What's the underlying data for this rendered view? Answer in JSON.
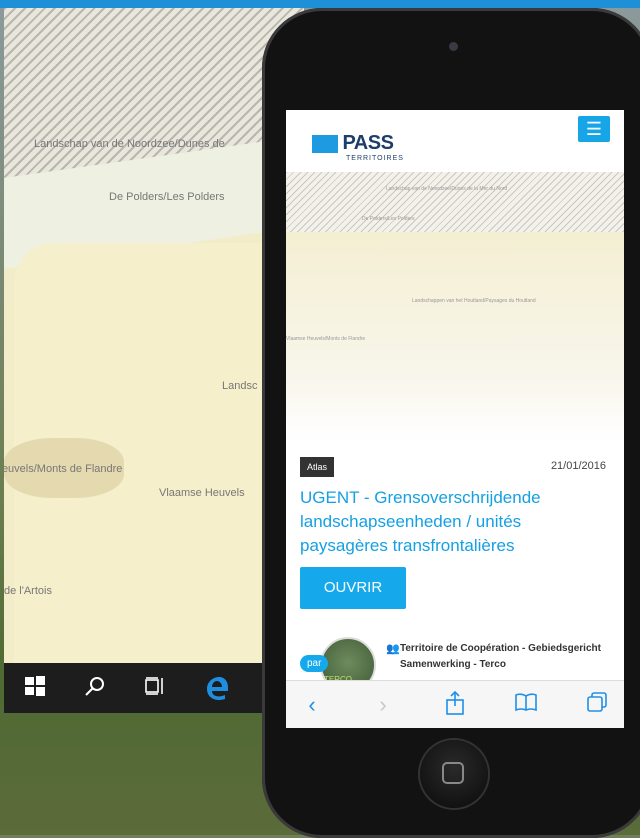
{
  "background_map": {
    "labels": [
      "Landschap van de Noordzee/Dunes de",
      "De Polders/Les Polders",
      "Landsc",
      "Heuvels/Monts de Flandre",
      "Vlaamse Heuvels",
      "de l'Artois"
    ]
  },
  "taskbar": {
    "icons": [
      "windows-logo-icon",
      "search-icon",
      "task-view-icon",
      "edge-browser-icon"
    ]
  },
  "site": {
    "logo_text": "PASS",
    "logo_sub": "TERRITOIRES",
    "menu_icon": "hamburger-icon"
  },
  "hero_map": {
    "labels": [
      "Landschap van de Noordzee/Dunes de la Mer du Nord",
      "De Polders/Les Polders",
      "Landschappen van het Houtland/Paysages du Houtland",
      "Vlaamse Heuvels/Monts de Flandre"
    ]
  },
  "article": {
    "tag": "Atlas",
    "date": "21/01/2016",
    "title": "UGENT - Grensoverschrijdende landschapseenheden / unités paysagères transfrontalières",
    "open_label": "OUVRIR",
    "by_label": "par",
    "avatar_label": "TERCO",
    "organization": "Territoire de Coopération - Gebiedsgericht Samenwerking - Terco"
  },
  "safari_toolbar": {
    "icons": [
      "back-icon",
      "forward-icon",
      "share-icon",
      "bookmarks-icon",
      "tabs-icon"
    ],
    "accent": "#1e90e8"
  },
  "colors": {
    "accent": "#15a9ec",
    "logo_blue": "#1d3d6b"
  }
}
